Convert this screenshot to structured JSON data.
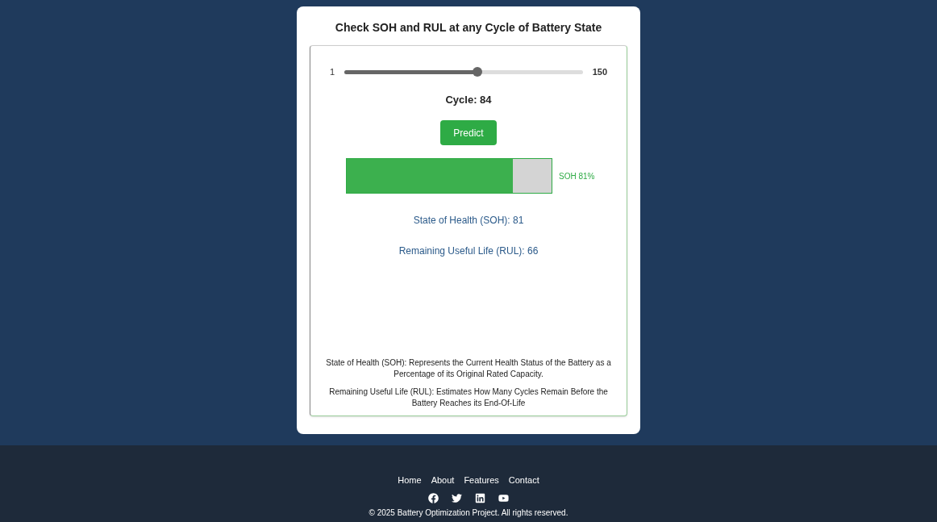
{
  "card": {
    "title": "Check SOH and RUL at any Cycle of Battery State",
    "slider": {
      "min_label": "1",
      "max_label": "150",
      "level": 0.557
    },
    "cycle_label": "Cycle: 84",
    "predict_button": "Predict",
    "soh_bar": {
      "level": 0.81,
      "label": "SOH 81%"
    },
    "soh_result": "State of Health (SOH): 81",
    "rul_result": "Remaining Useful Life (RUL): 66",
    "descriptions": [
      "State of Health (SOH): Represents the Current Health Status of the Battery as a Percentage of its Original Rated Capacity.",
      "Remaining Useful Life (RUL): Estimates How Many Cycles Remain Before the Battery Reaches its End-Of-Life"
    ]
  },
  "footer": {
    "links": [
      "Home",
      "About",
      "Features",
      "Contact"
    ],
    "copyright": "© 2025 Battery Optimization Project. All rights reserved."
  }
}
